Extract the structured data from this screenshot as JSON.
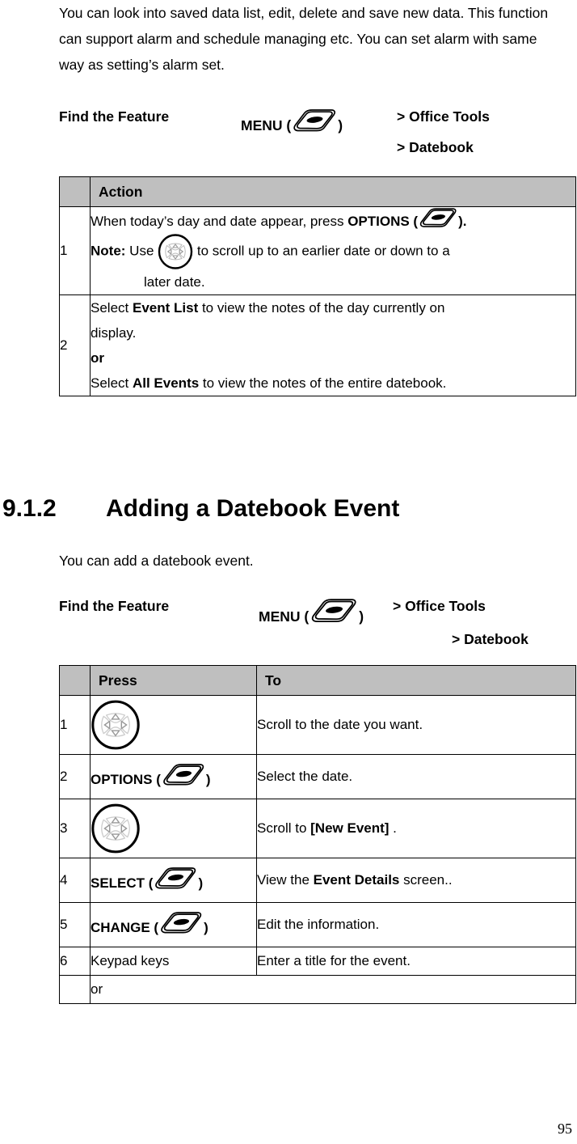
{
  "intro": {
    "paragraph": "You can look into saved data list, edit, delete and save new data. This function can support alarm and schedule managing etc. You can set alarm with same way as setting’s alarm set."
  },
  "find_feature_1": {
    "label": "Find the Feature",
    "menu_prefix": "MENU (",
    "menu_suffix": ")",
    "menu_icon": "softkey-menu-icon",
    "path_1": "> Office Tools",
    "path_2": "> Datebook"
  },
  "table_1": {
    "headers": {
      "number": "",
      "action": "Action"
    },
    "rows": [
      {
        "number": "1",
        "line_1_pre": "When today’s day and date appear, press ",
        "line_1_bold": "OPTIONS (",
        "line_1_icon": "softkey-options-icon",
        "line_1_post": ").",
        "line_2_bold": "Note:",
        "line_2_pre": " Use ",
        "line_2_icon": "navigation-key-icon",
        "line_2_post": " to scroll up to an earlier date or down to a",
        "line_3": "later date."
      },
      {
        "number": "2",
        "line_1_pre": "Select ",
        "line_1_bold": "Event List",
        "line_1_post": " to view the notes of the day currently on",
        "line_2": "display.",
        "line_3_bold": "or",
        "line_4_pre": "Select ",
        "line_4_bold": "All Events",
        "line_4_post": " to view the notes of the entire datebook."
      }
    ]
  },
  "section": {
    "number": "9.1.2",
    "title": "Adding a Datebook Event",
    "description": "You can add a datebook event."
  },
  "find_feature_2": {
    "label": "Find the Feature",
    "menu_prefix": "MENU (",
    "menu_suffix": ")",
    "menu_icon": "softkey-menu-icon",
    "path_1": "> Office Tools",
    "path_2": "> Datebook"
  },
  "table_2": {
    "headers": {
      "number": "",
      "press": "Press",
      "to": "To"
    },
    "rows": [
      {
        "number": "1",
        "press_icon": "navigation-key-icon",
        "press_label": "",
        "to": "Scroll to the date you want."
      },
      {
        "number": "2",
        "press_label": "OPTIONS (",
        "press_icon": "softkey-options-icon",
        "press_suffix": ")",
        "to": "Select the date."
      },
      {
        "number": "3",
        "press_icon": "navigation-key-icon",
        "press_label": "",
        "to_pre": "Scroll to ",
        "to_bold": "[New Event]",
        "to_post": " ."
      },
      {
        "number": "4",
        "press_label": "SELECT (",
        "press_icon": "softkey-select-icon",
        "press_suffix": ")",
        "to_pre": "View the ",
        "to_bold": "Event Details",
        "to_post": " screen.."
      },
      {
        "number": "5",
        "press_label": "CHANGE (",
        "press_icon": "softkey-change-icon",
        "press_suffix": ")",
        "to": "Edit the information."
      },
      {
        "number": "6",
        "press_label": "Keypad keys",
        "to": "Enter a title for the event."
      },
      {
        "number": "",
        "press_label": "or",
        "to": ""
      }
    ]
  },
  "footer": {
    "page_number": "95"
  },
  "colors": {
    "header_background": "#bfbfbf",
    "border": "#000000",
    "text": "#000000",
    "page_background": "#ffffff"
  }
}
